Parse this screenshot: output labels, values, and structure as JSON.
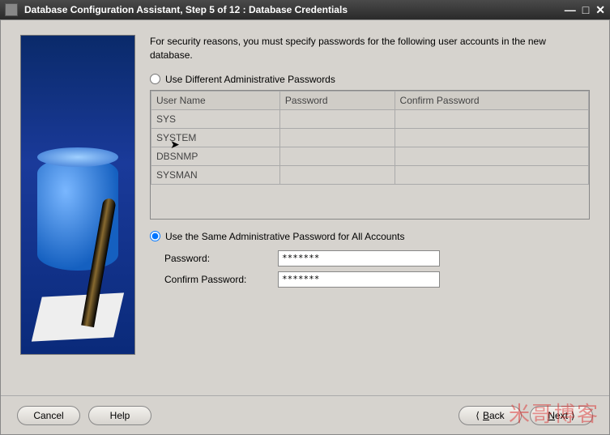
{
  "titlebar": {
    "title": "Database Configuration Assistant, Step 5 of 12 : Database Credentials"
  },
  "instruction": "For security reasons, you must specify passwords for the following user accounts in the new database.",
  "options": {
    "different_passwords_label": "Use Different Administrative Passwords",
    "same_password_label": "Use the Same Administrative Password for All Accounts",
    "selected": "same"
  },
  "user_table": {
    "headers": [
      "User Name",
      "Password",
      "Confirm Password"
    ],
    "rows": [
      {
        "user": "SYS",
        "password": "",
        "confirm": ""
      },
      {
        "user": "SYSTEM",
        "password": "",
        "confirm": ""
      },
      {
        "user": "DBSNMP",
        "password": "",
        "confirm": ""
      },
      {
        "user": "SYSMAN",
        "password": "",
        "confirm": ""
      }
    ]
  },
  "same_password_fields": {
    "password_label": "Password:",
    "password_value": "*******",
    "confirm_label": "Confirm Password:",
    "confirm_value": "*******"
  },
  "buttons": {
    "cancel": "Cancel",
    "help": "Help",
    "back": "Back",
    "next": "Next"
  },
  "watermark": "米哥博客"
}
